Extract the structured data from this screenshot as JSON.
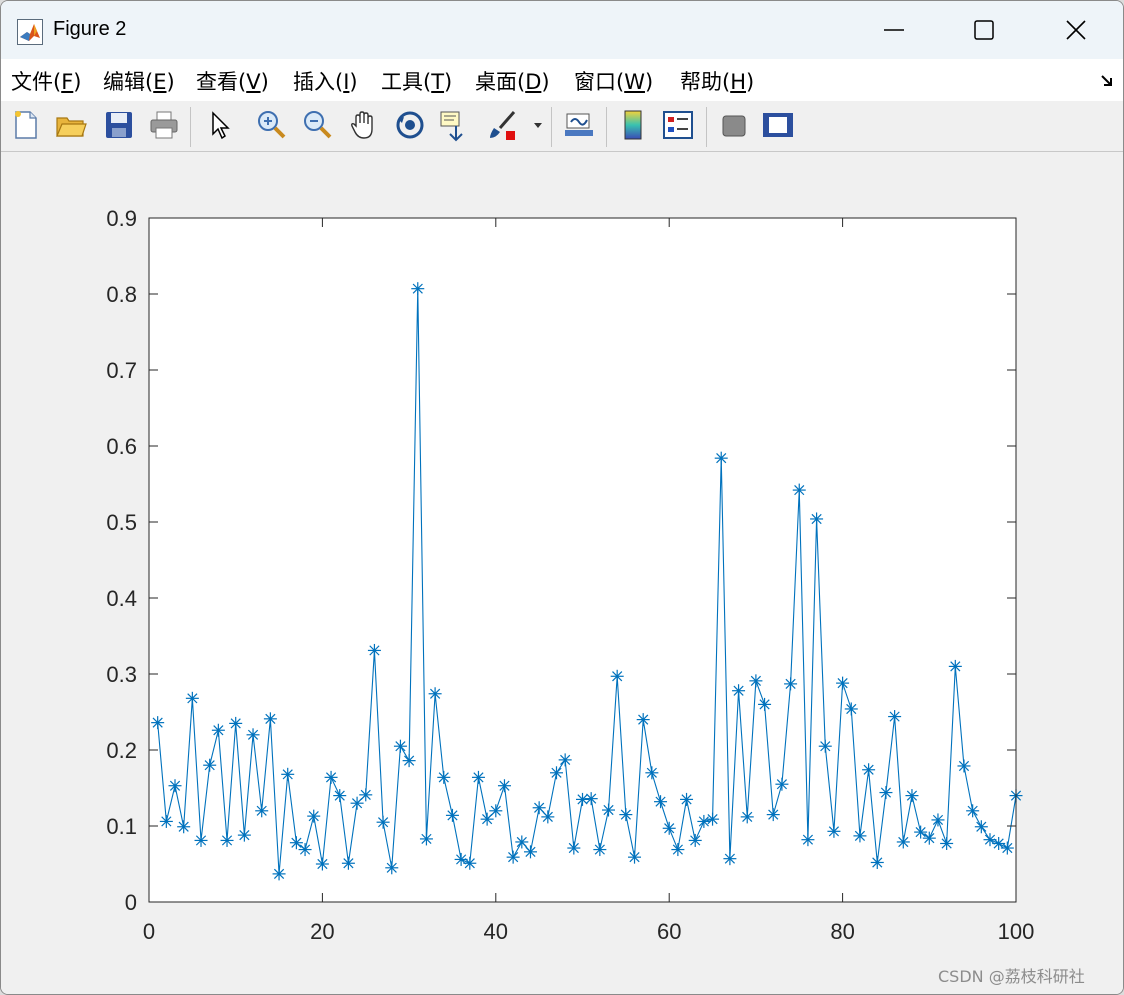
{
  "window": {
    "title": "Figure 2"
  },
  "titlebar_buttons": {
    "minimize": "minimize-icon",
    "maximize": "maximize-icon",
    "close": "close-icon"
  },
  "menu": [
    {
      "label": "文件(F)",
      "mnemonic": "F"
    },
    {
      "label": "编辑(E)",
      "mnemonic": "E"
    },
    {
      "label": "查看(V)",
      "mnemonic": "V"
    },
    {
      "label": "插入(I)",
      "mnemonic": "I"
    },
    {
      "label": "工具(T)",
      "mnemonic": "T"
    },
    {
      "label": "桌面(D)",
      "mnemonic": "D"
    },
    {
      "label": "窗口(W)",
      "mnemonic": "W"
    },
    {
      "label": "帮助(H)",
      "mnemonic": "H"
    }
  ],
  "toolbar": [
    "new-figure-icon",
    "open-file-icon",
    "save-icon",
    "print-icon",
    "pointer-icon",
    "zoom-in-icon",
    "zoom-out-icon",
    "pan-hand-icon",
    "rotate-3d-icon",
    "data-cursor-icon",
    "brush-icon",
    "brush-dropdown-icon",
    "link-plot-icon",
    "colorbar-icon",
    "legend-icon",
    "hide-plot-tools-icon",
    "show-plot-tools-icon"
  ],
  "colors": {
    "series": "#0072BD",
    "axis": "#262626",
    "window_bg": "#f0f0f0",
    "titlebar_bg": "#eef4f9"
  },
  "chart_data": {
    "type": "line",
    "marker": "*",
    "xlim": [
      0,
      100
    ],
    "ylim": [
      0,
      0.9
    ],
    "xticks": [
      0,
      20,
      40,
      60,
      80,
      100
    ],
    "yticks": [
      0,
      0.1,
      0.2,
      0.3,
      0.4,
      0.5,
      0.6,
      0.7,
      0.8,
      0.9
    ],
    "grid": false,
    "x": [
      1,
      2,
      3,
      4,
      5,
      6,
      7,
      8,
      9,
      10,
      11,
      12,
      13,
      14,
      15,
      16,
      17,
      18,
      19,
      20,
      21,
      22,
      23,
      24,
      25,
      26,
      27,
      28,
      29,
      30,
      31,
      32,
      33,
      34,
      35,
      36,
      37,
      38,
      39,
      40,
      41,
      42,
      43,
      44,
      45,
      46,
      47,
      48,
      49,
      50,
      51,
      52,
      53,
      54,
      55,
      56,
      57,
      58,
      59,
      60,
      61,
      62,
      63,
      64,
      65,
      66,
      67,
      68,
      69,
      70,
      71,
      72,
      73,
      74,
      75,
      76,
      77,
      78,
      79,
      80,
      81,
      82,
      83,
      84,
      85,
      86,
      87,
      88,
      89,
      90,
      91,
      92,
      93,
      94,
      95,
      96,
      97,
      98,
      99,
      100
    ],
    "y": [
      0.236,
      0.106,
      0.153,
      0.099,
      0.268,
      0.081,
      0.18,
      0.226,
      0.081,
      0.235,
      0.088,
      0.22,
      0.12,
      0.241,
      0.037,
      0.168,
      0.078,
      0.069,
      0.113,
      0.05,
      0.164,
      0.14,
      0.051,
      0.13,
      0.141,
      0.331,
      0.105,
      0.045,
      0.205,
      0.186,
      0.807,
      0.083,
      0.274,
      0.164,
      0.114,
      0.056,
      0.051,
      0.164,
      0.109,
      0.12,
      0.153,
      0.059,
      0.079,
      0.066,
      0.124,
      0.112,
      0.17,
      0.187,
      0.071,
      0.135,
      0.136,
      0.069,
      0.121,
      0.297,
      0.115,
      0.059,
      0.24,
      0.17,
      0.132,
      0.097,
      0.069,
      0.135,
      0.081,
      0.106,
      0.109,
      0.584,
      0.057,
      0.278,
      0.112,
      0.291,
      0.26,
      0.115,
      0.155,
      0.287,
      0.542,
      0.082,
      0.504,
      0.205,
      0.093,
      0.288,
      0.254,
      0.087,
      0.174,
      0.052,
      0.144,
      0.244,
      0.079,
      0.14,
      0.092,
      0.084,
      0.108,
      0.077,
      0.31,
      0.179,
      0.12,
      0.099,
      0.082,
      0.077,
      0.071,
      0.14
    ]
  },
  "watermark": "CSDN @荔枝科研社"
}
